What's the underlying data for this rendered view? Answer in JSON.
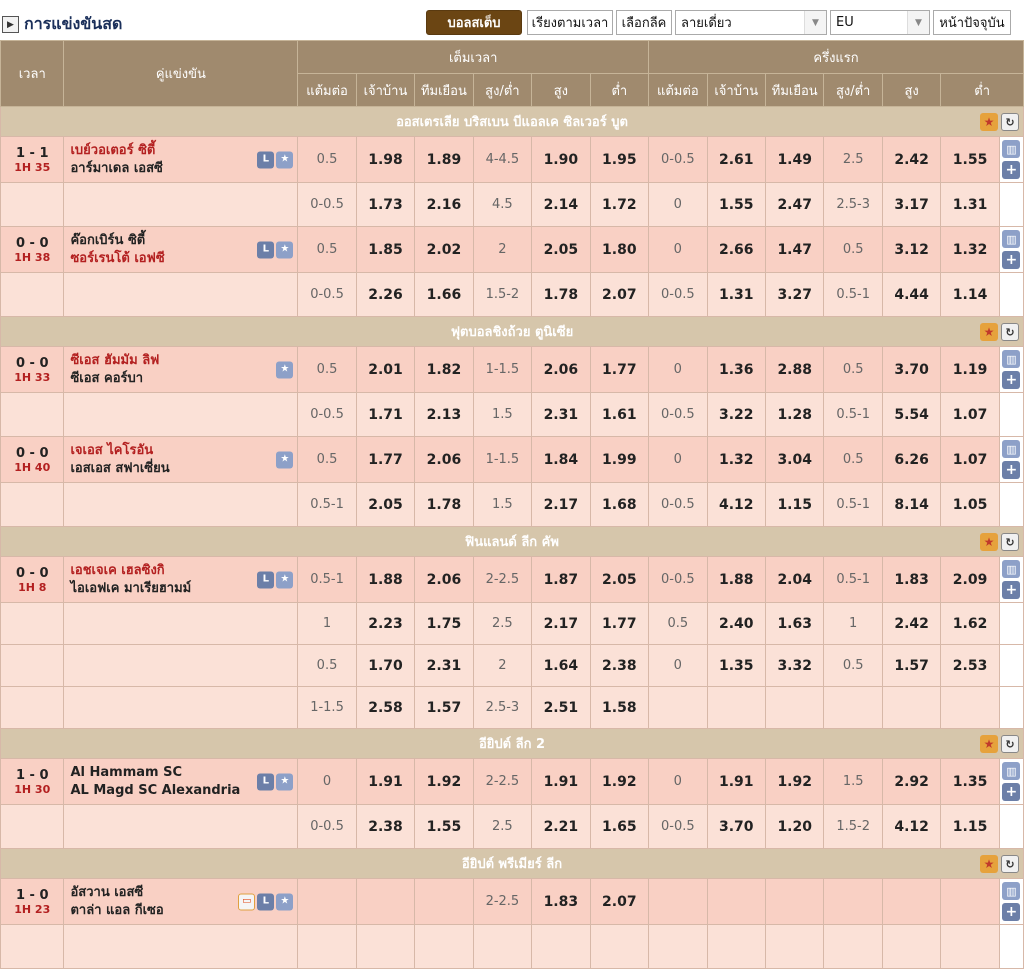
{
  "header": {
    "title": "การแข่งขันสด",
    "buttons": {
      "live": "บอลสเต็บ",
      "by_time": "เรียงตามเวลา",
      "select_league": "เลือกลีค",
      "today": "หน้าปัจจุบัน"
    },
    "view_select": "ลายเดี่ยว",
    "odds_format": "EU"
  },
  "table_head": {
    "time": "เวลา",
    "match": "คู่แข่งขัน",
    "full_time": "เต็มเวลา",
    "first_half": "ครึ่งแรก",
    "cols": [
      "แต้มต่อ",
      "เจ้าบ้าน",
      "ทีมเยือน",
      "สูง/ต่ำ",
      "สูง",
      "ต่ำ"
    ]
  },
  "leagues": [
    {
      "name": "ออสเตรเลีย บริสเบน บีแอลเค ซิลเวอร์ บูต",
      "matches": [
        {
          "score": "1 - 1",
          "period": "1H 35",
          "home": "เบย์วอเตอร์ ซิตี้",
          "away": "อาร์มาเดล เอสซี",
          "fav": "home",
          "live": true,
          "rows": [
            [
              "0.5",
              "1.98",
              "1.89",
              "4-4.5",
              "1.90",
              "1.95",
              "0-0.5",
              "2.61",
              "1.49",
              "2.5",
              "2.42",
              "1.55"
            ],
            [
              "0-0.5",
              "1.73",
              "2.16",
              "4.5",
              "2.14",
              "1.72",
              "0",
              "1.55",
              "2.47",
              "2.5-3",
              "3.17",
              "1.31"
            ]
          ]
        },
        {
          "score": "0 - 0",
          "period": "1H 38",
          "home": "ค๊อกเบิร์น ซิตี้",
          "away": "ซอร์เรนโต้ เอฟซี",
          "fav": "away",
          "live": true,
          "rows": [
            [
              "0.5",
              "1.85",
              "2.02",
              "2",
              "2.05",
              "1.80",
              "0",
              "2.66",
              "1.47",
              "0.5",
              "3.12",
              "1.32"
            ],
            [
              "0-0.5",
              "2.26",
              "1.66",
              "1.5-2",
              "1.78",
              "2.07",
              "0-0.5",
              "1.31",
              "3.27",
              "0.5-1",
              "4.44",
              "1.14"
            ]
          ]
        }
      ]
    },
    {
      "name": "ฟุตบอลชิงถ้วย ตูนิเซีย",
      "matches": [
        {
          "score": "0 - 0",
          "period": "1H 33",
          "home": "ซีเอส ฮัมมัม ลิฟ",
          "away": "ซีเอส คอร์บา",
          "fav": "home",
          "live": false,
          "rows": [
            [
              "0.5",
              "2.01",
              "1.82",
              "1-1.5",
              "2.06",
              "1.77",
              "0",
              "1.36",
              "2.88",
              "0.5",
              "3.70",
              "1.19"
            ],
            [
              "0-0.5",
              "1.71",
              "2.13",
              "1.5",
              "2.31",
              "1.61",
              "0-0.5",
              "3.22",
              "1.28",
              "0.5-1",
              "5.54",
              "1.07"
            ]
          ]
        },
        {
          "score": "0 - 0",
          "period": "1H 40",
          "home": "เจเอส ไคโรอัน",
          "away": "เอสเอส สฟาเซี่ยน",
          "fav": "home",
          "live": false,
          "rows": [
            [
              "0.5",
              "1.77",
              "2.06",
              "1-1.5",
              "1.84",
              "1.99",
              "0",
              "1.32",
              "3.04",
              "0.5",
              "6.26",
              "1.07"
            ],
            [
              "0.5-1",
              "2.05",
              "1.78",
              "1.5",
              "2.17",
              "1.68",
              "0-0.5",
              "4.12",
              "1.15",
              "0.5-1",
              "8.14",
              "1.05"
            ]
          ]
        }
      ]
    },
    {
      "name": "ฟินแลนด์ ลีก คัพ",
      "matches": [
        {
          "score": "0 - 0",
          "period": "1H 8",
          "home": "เอชเจเค เฮลซิงกิ",
          "away": "ไอเอฟเค มาเรียฮามม์",
          "fav": "home",
          "live": true,
          "rows": [
            [
              "0.5-1",
              "1.88",
              "2.06",
              "2-2.5",
              "1.87",
              "2.05",
              "0-0.5",
              "1.88",
              "2.04",
              "0.5-1",
              "1.83",
              "2.09"
            ],
            [
              "1",
              "2.23",
              "1.75",
              "2.5",
              "2.17",
              "1.77",
              "0.5",
              "2.40",
              "1.63",
              "1",
              "2.42",
              "1.62"
            ],
            [
              "0.5",
              "1.70",
              "2.31",
              "2",
              "1.64",
              "2.38",
              "0",
              "1.35",
              "3.32",
              "0.5",
              "1.57",
              "2.53"
            ],
            [
              "1-1.5",
              "2.58",
              "1.57",
              "2.5-3",
              "2.51",
              "1.58",
              "",
              "",
              "",
              "",
              "",
              ""
            ]
          ]
        }
      ]
    },
    {
      "name": "อียิปต์ ลีก 2",
      "matches": [
        {
          "score": "1 - 0",
          "period": "1H 30",
          "home": "Al Hammam SC",
          "away": "AL Magd SC Alexandria",
          "fav": "none",
          "live": true,
          "rows": [
            [
              "0",
              "1.91",
              "1.92",
              "2-2.5",
              "1.91",
              "1.92",
              "0",
              "1.91",
              "1.92",
              "1.5",
              "2.92",
              "1.35"
            ],
            [
              "0-0.5",
              "2.38",
              "1.55",
              "2.5",
              "2.21",
              "1.65",
              "0-0.5",
              "3.70",
              "1.20",
              "1.5-2",
              "4.12",
              "1.15"
            ]
          ]
        }
      ]
    },
    {
      "name": "อียิปต์ พรีเมียร์ ลีก",
      "matches": [
        {
          "score": "1 - 0",
          "period": "1H 23",
          "home": "อัสวาน เอสซี",
          "away": "ตาล่า แอล กีเซอ",
          "fav": "none",
          "live": true,
          "tv": true,
          "rows": [
            [
              "",
              "",
              "",
              "2-2.5",
              "1.83",
              "2.07",
              "",
              "",
              "",
              "",
              "",
              ""
            ],
            [
              "",
              "",
              "",
              "",
              "",
              "",
              "",
              "",
              "",
              "",
              "",
              ""
            ]
          ]
        }
      ]
    }
  ],
  "icons": {
    "live": "L",
    "fav_star": "star-icon",
    "stats": "bar-chart-icon",
    "add": "+"
  }
}
